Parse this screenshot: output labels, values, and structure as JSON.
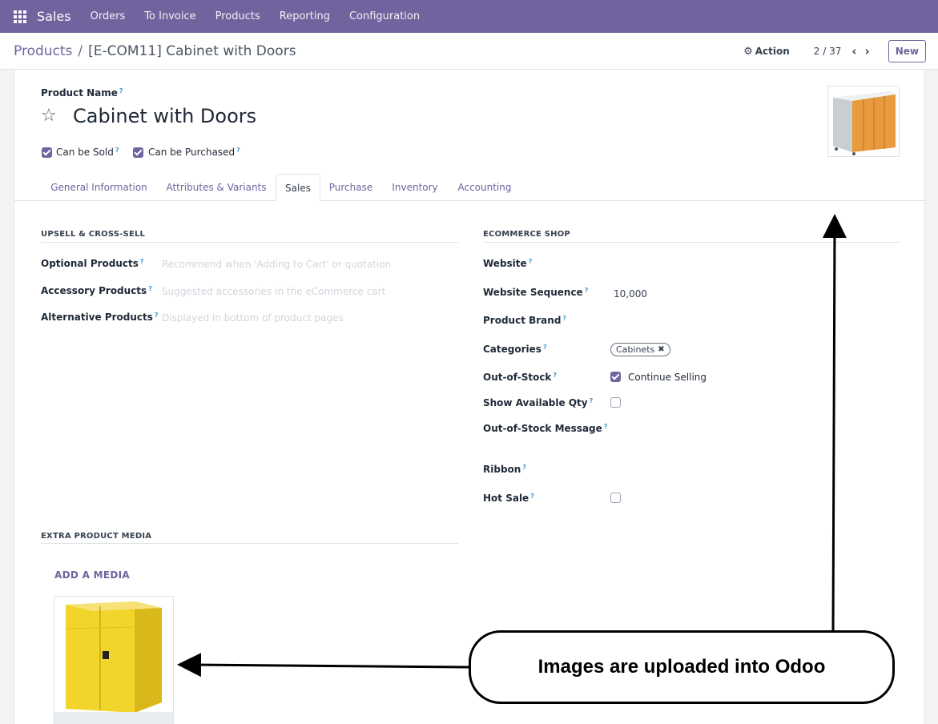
{
  "navbar": {
    "app_name": "Sales",
    "items": [
      "Orders",
      "To Invoice",
      "Products",
      "Reporting",
      "Configuration"
    ]
  },
  "control": {
    "breadcrumb_parent": "Products",
    "breadcrumb_separator": "/",
    "breadcrumb_current": "[E-COM11] Cabinet with Doors",
    "action_label": "Action",
    "pager": "2 / 37",
    "new_label": "New"
  },
  "product": {
    "name_label": "Product Name",
    "name": "Cabinet with Doors",
    "can_be_sold_label": "Can be Sold",
    "can_be_sold": true,
    "can_be_purchased_label": "Can be Purchased",
    "can_be_purchased": true
  },
  "tabs": [
    {
      "label": "General Information"
    },
    {
      "label": "Attributes & Variants"
    },
    {
      "label": "Sales",
      "active": true
    },
    {
      "label": "Purchase"
    },
    {
      "label": "Inventory"
    },
    {
      "label": "Accounting"
    }
  ],
  "upsell": {
    "title": "UPSELL & CROSS-SELL",
    "optional_label": "Optional Products",
    "optional_placeholder": "Recommend when 'Adding to Cart' or quotation",
    "accessory_label": "Accessory Products",
    "accessory_placeholder": "Suggested accessories in the eCommerce cart",
    "alternative_label": "Alternative Products",
    "alternative_placeholder": "Displayed in bottom of product pages"
  },
  "ecommerce": {
    "title": "ECOMMERCE SHOP",
    "website_label": "Website",
    "sequence_label": "Website Sequence",
    "sequence_value": "10,000",
    "brand_label": "Product Brand",
    "categories_label": "Categories",
    "category_tag": "Cabinets",
    "out_of_stock_label": "Out-of-Stock",
    "continue_selling_label": "Continue Selling",
    "continue_selling": true,
    "show_qty_label": "Show Available Qty",
    "show_qty": false,
    "oos_message_label": "Out-of-Stock Message",
    "ribbon_label": "Ribbon",
    "hot_sale_label": "Hot Sale",
    "hot_sale": false
  },
  "media": {
    "title": "EXTRA PRODUCT MEDIA",
    "add_label": "ADD A MEDIA"
  },
  "annotation": {
    "text": "Images are uploaded into Odoo"
  },
  "colors": {
    "brand": "#71639e",
    "help": "#3b9ad9",
    "cabinet_orange": "#e89a3c",
    "cabinet_yellow": "#f2d52a"
  }
}
